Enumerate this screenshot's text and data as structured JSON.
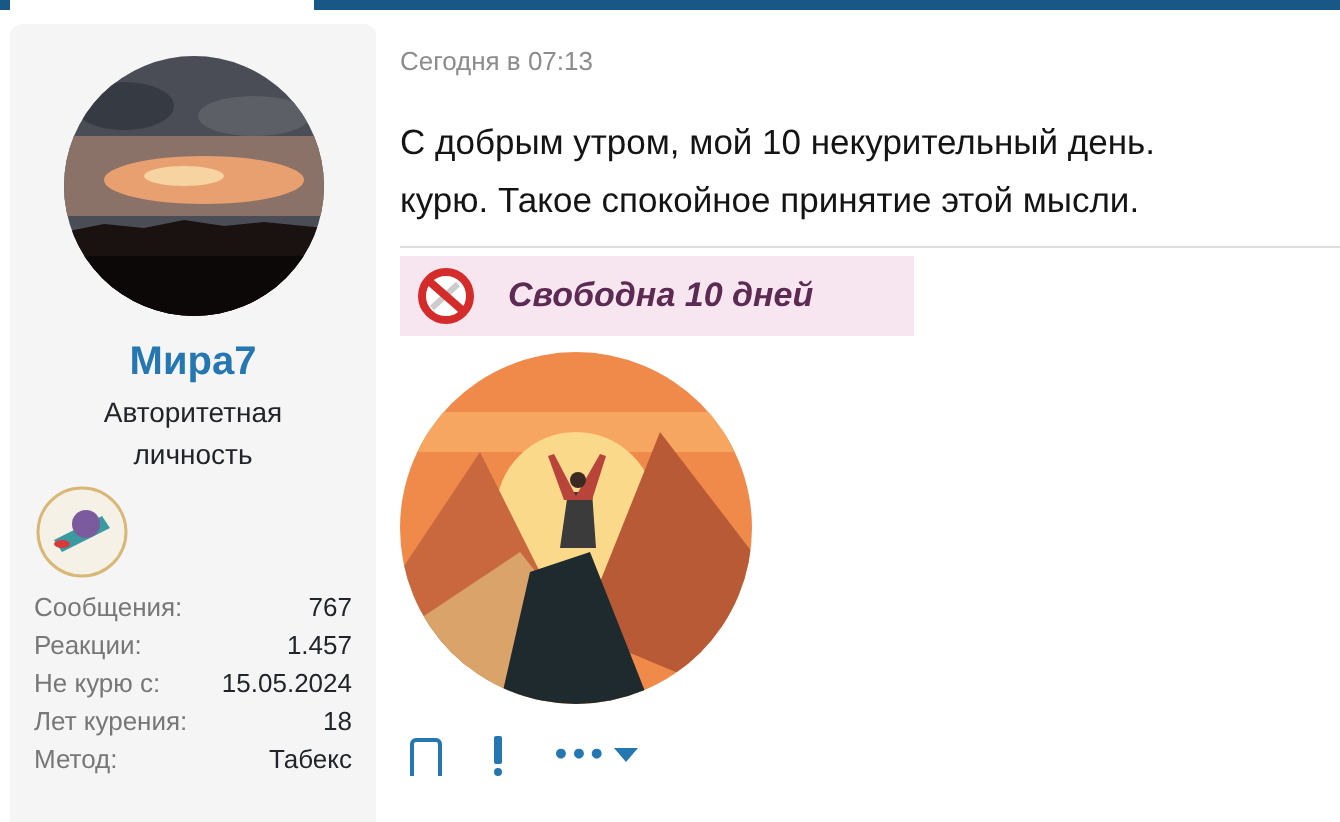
{
  "user": {
    "avatar": {
      "kind": "picture"
    },
    "name": "Мира7",
    "title": "Авторитетная личность",
    "stats": [
      {
        "label": "Сообщения:",
        "value": "767"
      },
      {
        "label": "Реакции:",
        "value": "1.457"
      },
      {
        "label": "Не курю с:",
        "value": "15.05.2024"
      },
      {
        "label": "Лет курения:",
        "value": "18"
      },
      {
        "label": "Метод:",
        "value": "Табекс"
      }
    ]
  },
  "post": {
    "time": "Сегодня в 07:13",
    "lines": [
      "С добрым утром, мой 10 некурительный день.",
      "курю. Такое спокойное принятие этой мысли."
    ],
    "signature_banner": "Свободна 10 дней",
    "signature_image": {
      "kind": "picture"
    },
    "actions": [
      "•••"
    ]
  }
}
